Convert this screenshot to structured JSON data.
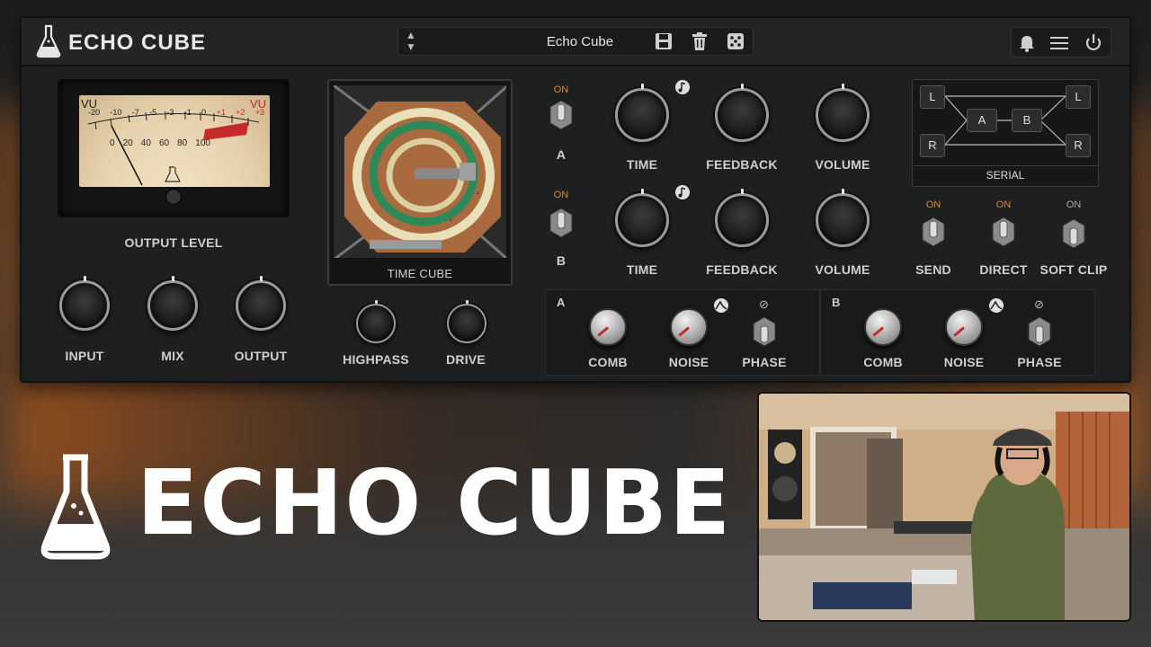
{
  "plugin": {
    "title": "ECHO CUBE",
    "preset": {
      "name": "Echo Cube"
    },
    "output_level_label": "OUTPUT LEVEL",
    "vu": {
      "left_label": "VU",
      "right_label": "VU",
      "scale_top": [
        "-20",
        "-10",
        "-7",
        "-5",
        "-3",
        "-1",
        "0",
        "+1",
        "+2",
        "+3"
      ],
      "scale_bottom": [
        "0",
        "20",
        "40",
        "60",
        "80",
        "100"
      ]
    },
    "knobs_left": [
      "INPUT",
      "MIX",
      "OUTPUT"
    ],
    "time_cube_label": "TIME CUBE",
    "knobs_mid": [
      "HIGHPASS",
      "DRIVE"
    ],
    "head_a": {
      "switch_label": "A",
      "on": "ON",
      "knobs": [
        "TIME",
        "FEEDBACK",
        "VOLUME"
      ]
    },
    "head_b": {
      "switch_label": "B",
      "on": "ON",
      "knobs": [
        "TIME",
        "FEEDBACK",
        "VOLUME"
      ]
    },
    "routing": {
      "mode": "SERIAL",
      "nodes": {
        "l1": "L",
        "l2": "L",
        "r1": "R",
        "r2": "R",
        "a": "A",
        "b": "B"
      }
    },
    "switches_right": [
      {
        "on": "ON",
        "label": "SEND"
      },
      {
        "on": "ON",
        "label": "DIRECT"
      },
      {
        "on": "ON",
        "label": "SOFT CLIP"
      }
    ],
    "section_a": {
      "letter": "A",
      "labels": [
        "COMB",
        "NOISE",
        "PHASE"
      ]
    },
    "section_b": {
      "letter": "B",
      "labels": [
        "COMB",
        "NOISE",
        "PHASE"
      ]
    }
  },
  "thumbnail_title": "ECHO CUBE",
  "colors": {
    "accent_orange": "#d88a2e",
    "vu_red": "#c62b2b",
    "panel": "#1e1f20"
  },
  "icons": [
    "flask-icon",
    "updown-arrows-icon",
    "save-icon",
    "trash-icon",
    "dice-icon",
    "bell-icon",
    "menu-icon",
    "power-icon",
    "note-icon",
    "envelope-icon",
    "phase-icon"
  ]
}
